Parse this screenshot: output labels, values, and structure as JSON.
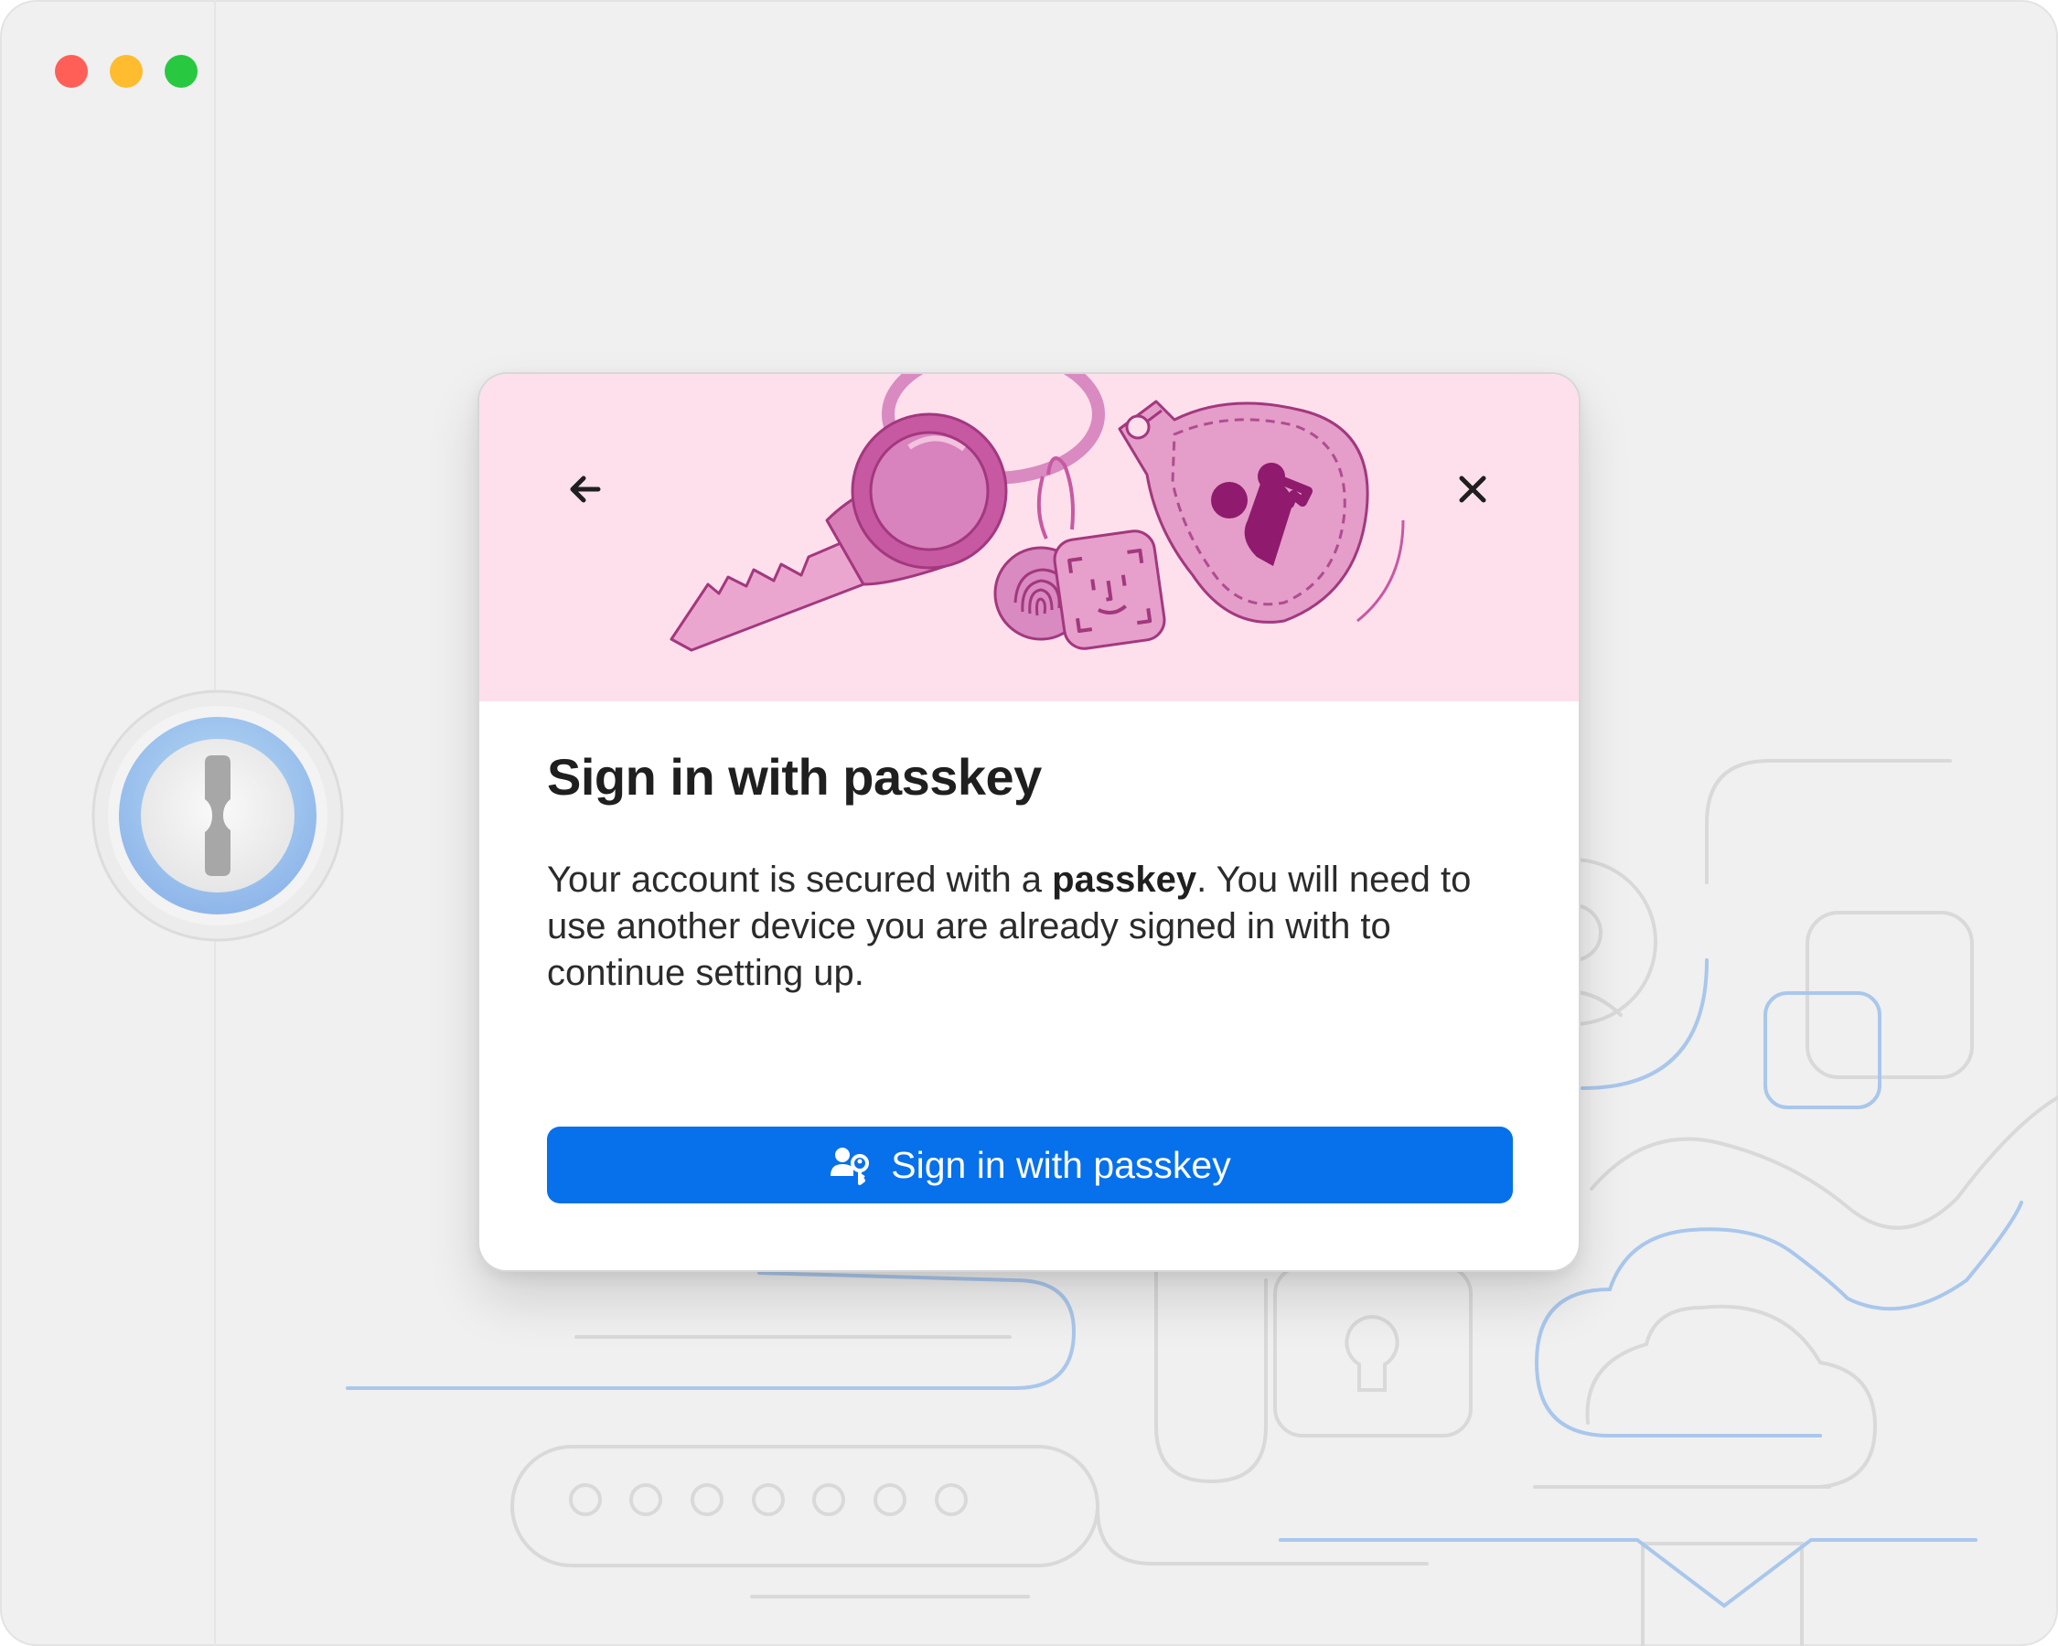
{
  "window": {
    "controls": [
      "close",
      "minimize",
      "maximize"
    ],
    "colors": {
      "close": "#ff5f57",
      "minimize": "#febc2e",
      "maximize": "#28c840"
    }
  },
  "app": {
    "logo_icon": "keyhole-logo-icon"
  },
  "dialog": {
    "back_icon": "arrow-left-icon",
    "close_icon": "close-x-icon",
    "hero_illustration": "passkey-keyring-illustration",
    "title": "Sign in with passkey",
    "body_prefix": "Your account is secured with a ",
    "body_bold": "passkey",
    "body_suffix": ". You will need to use another device you are already signed in with to continue setting up.",
    "primary_button": {
      "icon": "user-key-icon",
      "label": "Sign in with passkey"
    }
  },
  "colors": {
    "accent": "#0770eb",
    "hero_background": "#fde0ec",
    "illustration": "#c2559f"
  }
}
